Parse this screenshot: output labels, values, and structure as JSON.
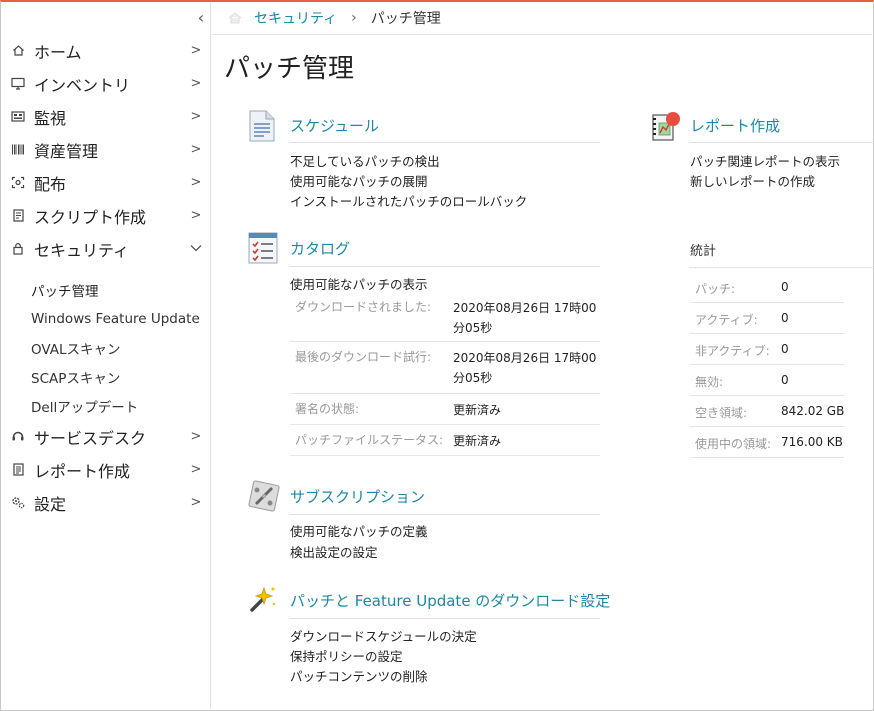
{
  "sidebar": {
    "items": [
      {
        "label": "ホーム",
        "icon": "home-icon"
      },
      {
        "label": "インベントリ",
        "icon": "monitor-icon"
      },
      {
        "label": "監視",
        "icon": "dashboard-icon"
      },
      {
        "label": "資産管理",
        "icon": "barcode-icon"
      },
      {
        "label": "配布",
        "icon": "deploy-icon"
      },
      {
        "label": "スクリプト作成",
        "icon": "script-icon"
      },
      {
        "label": "セキュリティ",
        "icon": "lock-icon"
      },
      {
        "label": "サービスデスク",
        "icon": "service-desk-icon"
      },
      {
        "label": "レポート作成",
        "icon": "report-icon"
      },
      {
        "label": "設定",
        "icon": "settings-icon"
      }
    ],
    "security_sub": [
      "パッチ管理",
      "Windows Feature Update",
      "OVALスキャン",
      "SCAPスキャン",
      "Dellアップデート"
    ]
  },
  "breadcrumb": {
    "parent": "セキュリティ",
    "sep": "›",
    "current": "パッチ管理"
  },
  "page_title": "パッチ管理",
  "schedule": {
    "title": "スケジュール",
    "links": [
      "不足しているパッチの検出",
      "使用可能なパッチの展開",
      "インストールされたパッチのロールバック"
    ]
  },
  "catalog": {
    "title": "カタログ",
    "link": "使用可能なパッチの表示",
    "rows": [
      {
        "k": "ダウンロードされました:",
        "v": "2020年08月26日 17時00分05秒"
      },
      {
        "k": "最後のダウンロード試行:",
        "v": "2020年08月26日 17時00分05秒"
      },
      {
        "k": "署名の状態:",
        "v": "更新済み"
      },
      {
        "k": "パッチファイルステータス:",
        "v": "更新済み"
      }
    ]
  },
  "subscription": {
    "title": "サブスクリプション",
    "links": [
      "使用可能なパッチの定義",
      "検出設定の設定"
    ]
  },
  "download": {
    "title": "パッチと Feature Update のダウンロード設定",
    "links": [
      "ダウンロードスケジュールの決定",
      "保持ポリシーの設定",
      "パッチコンテンツの削除"
    ]
  },
  "reports": {
    "title": "レポート作成",
    "links": [
      "パッチ関連レポートの表示",
      "新しいレポートの作成"
    ]
  },
  "stats": {
    "title": "統計",
    "rows": [
      {
        "k": "パッチ:",
        "v": "0"
      },
      {
        "k": "アクティブ:",
        "v": "0"
      },
      {
        "k": "非アクティブ:",
        "v": "0"
      },
      {
        "k": "無効:",
        "v": "0"
      },
      {
        "k": "空き領域:",
        "v": "842.02 GB"
      },
      {
        "k": "使用中の領域:",
        "v": "716.00 KB"
      }
    ]
  },
  "colors": {
    "accent": "#1a88a8",
    "top_border": "#e8603c"
  }
}
